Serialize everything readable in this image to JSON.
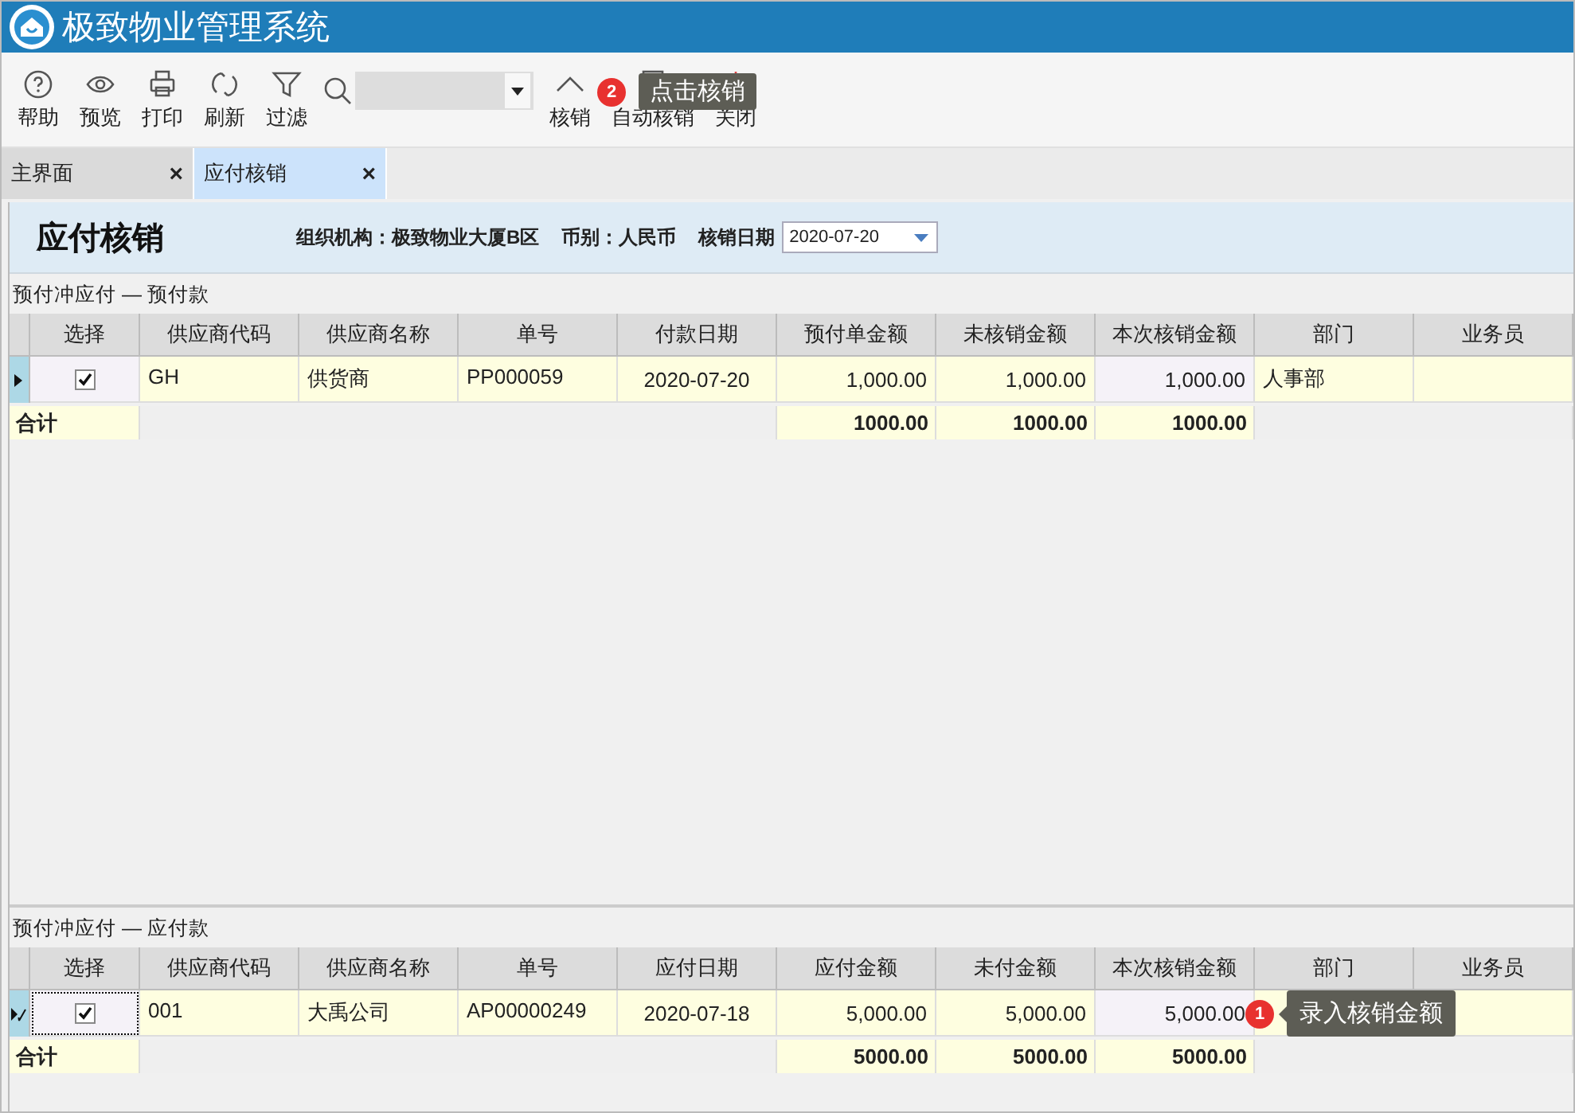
{
  "window": {
    "title": "极致物业管理系统"
  },
  "toolbar": [
    {
      "label": "帮助",
      "kind": "help"
    },
    {
      "label": "预览",
      "kind": "eye"
    },
    {
      "label": "打印",
      "kind": "printer"
    },
    {
      "label": "刷新",
      "kind": "refresh"
    },
    {
      "label": "过滤",
      "kind": "filter"
    },
    {
      "kind": "search"
    },
    {
      "label": "核销",
      "kind": "chevron"
    },
    {
      "label": "自动核销",
      "kind": "checklist"
    },
    {
      "label": "关闭",
      "kind": "power"
    }
  ],
  "tabs": [
    {
      "label": "主界面",
      "selected": false,
      "close": "×"
    },
    {
      "label": "应付核销",
      "selected": true,
      "close": "×"
    }
  ],
  "header": {
    "title": "应付核销",
    "org": "组织机构：极致物业大厦B区",
    "currency": "币别：人民币",
    "date_label": "核销日期",
    "date_value": "2020-07-20"
  },
  "grids": [
    {
      "caption": "预付冲应付 — 预付款",
      "select_column": "选择",
      "columns": [
        {
          "label": "供应商代码",
          "kind": "text"
        },
        {
          "label": "供应商名称",
          "kind": "text"
        },
        {
          "label": "单号",
          "kind": "text"
        },
        {
          "label": "付款日期",
          "kind": "date"
        },
        {
          "label": "预付单金额",
          "kind": "amount"
        },
        {
          "label": "未核销金额",
          "kind": "amount"
        },
        {
          "label": "本次核销金额",
          "kind": "input"
        },
        {
          "label": "部门",
          "kind": "text"
        },
        {
          "label": "业务员",
          "kind": "text"
        }
      ],
      "rows": [
        {
          "current": true,
          "editing": false,
          "checked": true,
          "cells": [
            "GH",
            "供货商",
            "PP000059",
            "2020-07-20",
            "1,000.00",
            "1,000.00",
            "1,000.00",
            "人事部"
          ]
        }
      ],
      "totals": {
        "label": "合计",
        "amounts": [
          "1000.00",
          "1000.00",
          "1000.00"
        ]
      }
    },
    {
      "caption": "预付冲应付 — 应付款",
      "select_column": "选择",
      "columns": [
        {
          "label": "供应商代码",
          "kind": "text"
        },
        {
          "label": "供应商名称",
          "kind": "text"
        },
        {
          "label": "单号",
          "kind": "text"
        },
        {
          "label": "应付日期",
          "kind": "date"
        },
        {
          "label": "应付金额",
          "kind": "amount"
        },
        {
          "label": "未付金额",
          "kind": "amount"
        },
        {
          "label": "本次核销金额",
          "kind": "input"
        },
        {
          "label": "部门",
          "kind": "text"
        },
        {
          "label": "业务员",
          "kind": "text"
        }
      ],
      "rows": [
        {
          "current": true,
          "editing": true,
          "checked": true,
          "cells": [
            "001",
            "大禹公司",
            "AP00000249",
            "2020-07-18",
            "5,000.00",
            "5,000.00",
            "5,000.00"
          ]
        }
      ],
      "totals": {
        "label": "合计",
        "amounts": [
          "5000.00",
          "5000.00",
          "5000.00"
        ]
      }
    }
  ],
  "callouts": [
    {
      "number": "2",
      "text": "点击核销"
    },
    {
      "number": "1",
      "text": "录入核销金额"
    }
  ]
}
